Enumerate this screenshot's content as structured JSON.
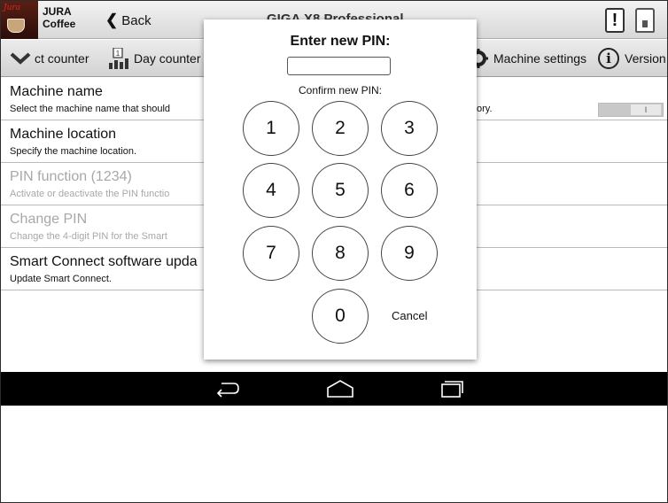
{
  "header": {
    "logo_script": "Jura",
    "brand_name": "JURA",
    "brand_sub": "Coffee",
    "back_label": "Back",
    "title": "GIGA X8 Professional"
  },
  "tabs": [
    {
      "label": "ct counter",
      "icon": "chevron-down-icon"
    },
    {
      "label": "Day counter",
      "icon": "day-counter-icon"
    },
    {
      "label": "Machine settings",
      "icon": "gear-icon"
    },
    {
      "label": "Version",
      "icon": "info-icon"
    }
  ],
  "settings": [
    {
      "title": "Machine name",
      "desc": "Select the machine name that should",
      "desc_tail": "ory."
    },
    {
      "title": "Machine location",
      "desc": "Specify the machine location."
    },
    {
      "title": "PIN function (1234)",
      "desc": "Activate or deactivate the PIN functio",
      "disabled": true,
      "toggle": "I"
    },
    {
      "title": "Change PIN",
      "desc": "Change the 4-digit PIN for the Smart",
      "disabled": true
    },
    {
      "title": "Smart Connect software upda",
      "desc": "Update Smart Connect."
    }
  ],
  "dialog": {
    "title": "Enter new PIN:",
    "pin_value": "",
    "confirm_label": "Confirm new PIN:",
    "keys": [
      "1",
      "2",
      "3",
      "4",
      "5",
      "6",
      "7",
      "8",
      "9",
      "0"
    ],
    "cancel_label": "Cancel"
  },
  "navbar": {
    "icons": [
      "back-icon",
      "home-icon",
      "recent-apps-icon"
    ]
  },
  "colors": {
    "disabled_text": "#a8a8a8",
    "navbar": "#000000",
    "logo_bg": "#2a0d08"
  }
}
